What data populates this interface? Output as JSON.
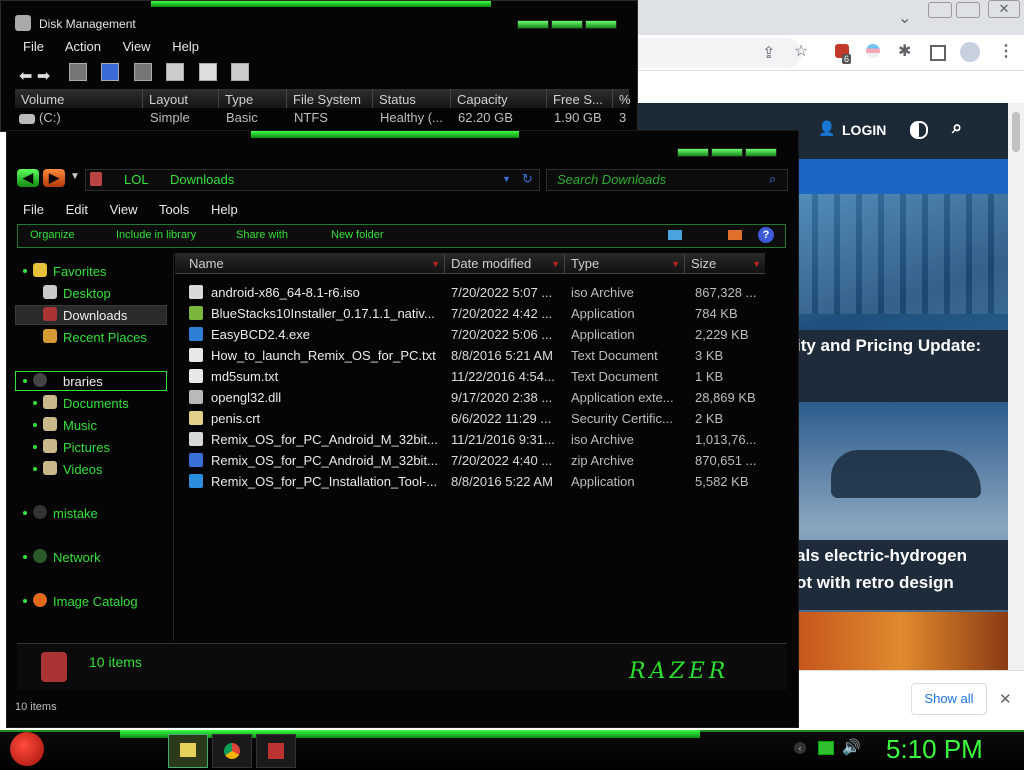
{
  "browser": {
    "nav_login": "LOGIN",
    "headline1": "ity and Pricing Update:",
    "headline2_line1": "als electric-hydrogen",
    "headline2_line2": "ot with retro design",
    "show_all": "Show all",
    "ext_badge": "6"
  },
  "disk_mgmt": {
    "title": "Disk Management",
    "menu": [
      "File",
      "Action",
      "View",
      "Help"
    ],
    "columns": [
      "Volume",
      "Layout",
      "Type",
      "File System",
      "Status",
      "Capacity",
      "Free S...",
      "%"
    ],
    "row": [
      "(C:)",
      "Simple",
      "Basic",
      "NTFS",
      "Healthy (...",
      "62.20 GB",
      "1.90 GB",
      "3"
    ]
  },
  "explorer": {
    "breadcrumb": [
      "LOL",
      "Downloads"
    ],
    "search_placeholder": "Search Downloads",
    "menu": [
      "File",
      "Edit",
      "View",
      "Tools",
      "Help"
    ],
    "commands": [
      "Organize",
      "Include in library",
      "Share with",
      "New folder"
    ],
    "nav": {
      "favorites": "Favorites",
      "desktop": "Desktop",
      "downloads": "Downloads",
      "recent": "Recent Places",
      "libraries": "braries",
      "documents": "Documents",
      "music": "Music",
      "pictures": "Pictures",
      "videos": "Videos",
      "mistake": "mistake",
      "network": "Network",
      "image_catalog": "Image Catalog"
    },
    "columns": [
      "Name",
      "Date modified",
      "Type",
      "Size"
    ],
    "files": [
      {
        "name": "android-x86_64-8.1-r6.iso",
        "date": "7/20/2022 5:07 ...",
        "type": "iso Archive",
        "size": "867,328 ...",
        "icon_color": "#d8d8d8"
      },
      {
        "name": "BlueStacks10Installer_0.17.1.1_nativ...",
        "date": "7/20/2022 4:42 ...",
        "type": "Application",
        "size": "784 KB",
        "icon_color": "#7ab63c"
      },
      {
        "name": "EasyBCD2.4.exe",
        "date": "7/20/2022 5:06 ...",
        "type": "Application",
        "size": "2,229 KB",
        "icon_color": "#2f7fd6"
      },
      {
        "name": "How_to_launch_Remix_OS_for_PC.txt",
        "date": "8/8/2016 5:21 AM",
        "type": "Text Document",
        "size": "3 KB",
        "icon_color": "#e8e8e8"
      },
      {
        "name": "md5sum.txt",
        "date": "11/22/2016 4:54...",
        "type": "Text Document",
        "size": "1 KB",
        "icon_color": "#e8e8e8"
      },
      {
        "name": "opengl32.dll",
        "date": "9/17/2020 2:38 ...",
        "type": "Application exte...",
        "size": "28,869 KB",
        "icon_color": "#b9b9b9"
      },
      {
        "name": "penis.crt",
        "date": "6/6/2022 11:29 ...",
        "type": "Security Certific...",
        "size": "2 KB",
        "icon_color": "#e0d08a"
      },
      {
        "name": "Remix_OS_for_PC_Android_M_32bit...",
        "date": "11/21/2016 9:31...",
        "type": "iso Archive",
        "size": "1,013,76...",
        "icon_color": "#d8d8d8"
      },
      {
        "name": "Remix_OS_for_PC_Android_M_32bit...",
        "date": "7/20/2022 4:40 ...",
        "type": "zip Archive",
        "size": "870,651 ...",
        "icon_color": "#3a6fd8"
      },
      {
        "name": "Remix_OS_for_PC_Installation_Tool-...",
        "date": "8/8/2016 5:22 AM",
        "type": "Application",
        "size": "5,582 KB",
        "icon_color": "#2a8de0"
      }
    ],
    "item_count": "10 items",
    "status_text": "10 items",
    "brand": "RAZER"
  },
  "taskbar": {
    "clock": "5:10 PM"
  },
  "colors": {
    "accent_green": "#34e03a",
    "window_bg": "#050505",
    "browser_header": "#1c2a38"
  }
}
